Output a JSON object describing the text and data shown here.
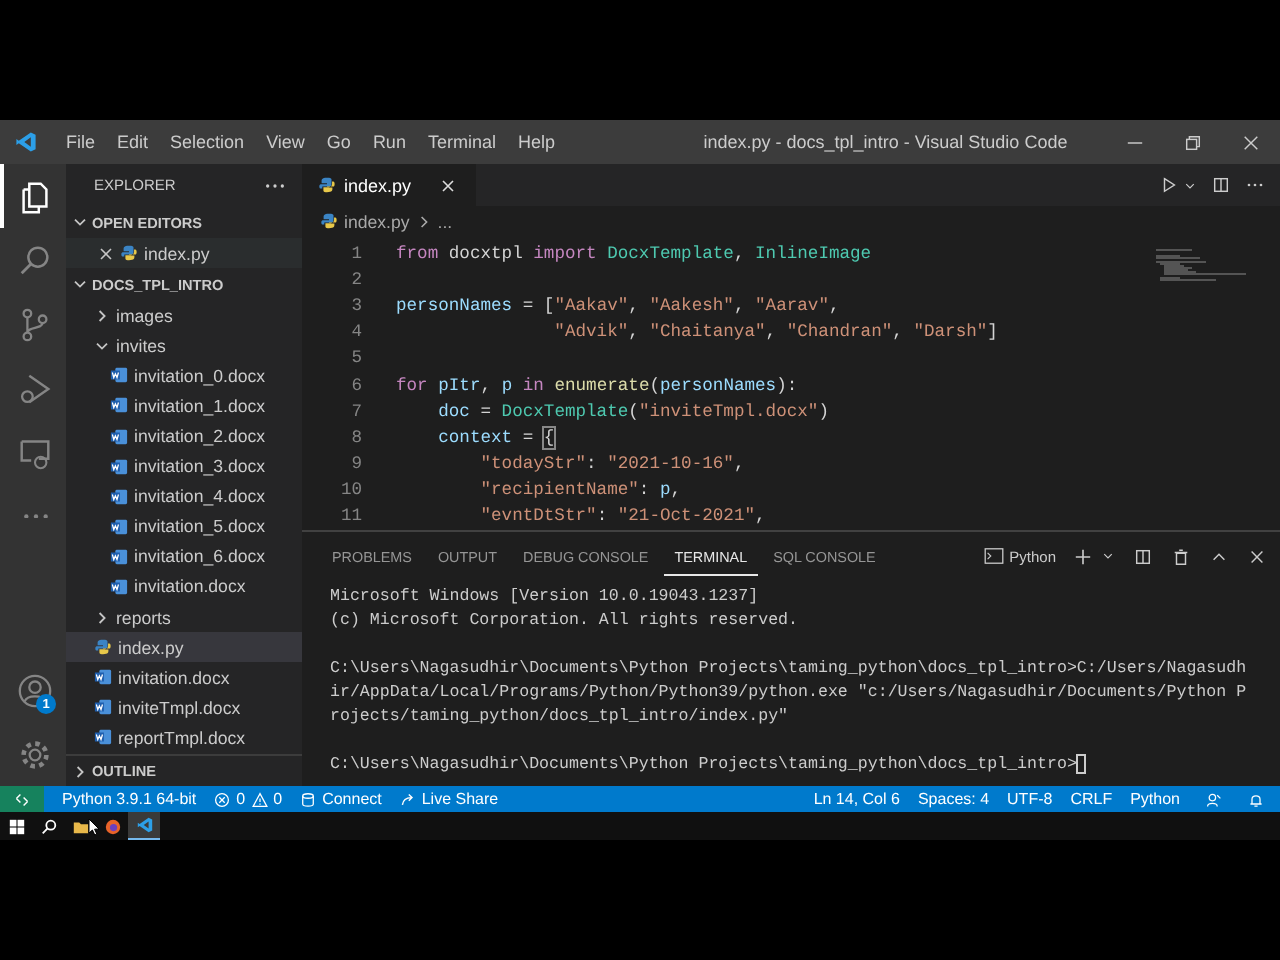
{
  "window": {
    "title": "index.py - docs_tpl_intro - Visual Studio Code"
  },
  "menu": [
    "File",
    "Edit",
    "Selection",
    "View",
    "Go",
    "Run",
    "Terminal",
    "Help"
  ],
  "activity_bar": [
    {
      "kind": "files",
      "selected": true
    },
    {
      "kind": "search",
      "selected": false
    },
    {
      "kind": "source-control",
      "selected": false
    },
    {
      "kind": "run",
      "selected": false
    },
    {
      "kind": "remote",
      "selected": false
    },
    {
      "kind": "more",
      "selected": false
    }
  ],
  "accounts": {
    "badge": "1"
  },
  "sidebar": {
    "title": "EXPLORER",
    "open_editors": {
      "label": "OPEN EDITORS",
      "expanded": true,
      "items": [
        {
          "name": "index.py",
          "kind": "py",
          "selected": true
        }
      ]
    },
    "folder": {
      "label": "DOCS_TPL_INTRO",
      "expanded": true,
      "items": [
        {
          "name": "images",
          "kind": "folder",
          "expanded": false,
          "selected": false
        },
        {
          "name": "invites",
          "kind": "folder",
          "expanded": true,
          "selected": false,
          "children": [
            {
              "name": "invitation_0.docx",
              "kind": "docx",
              "selected": false
            },
            {
              "name": "invitation_1.docx",
              "kind": "docx",
              "selected": false
            },
            {
              "name": "invitation_2.docx",
              "kind": "docx",
              "selected": false
            },
            {
              "name": "invitation_3.docx",
              "kind": "docx",
              "selected": false
            },
            {
              "name": "invitation_4.docx",
              "kind": "docx",
              "selected": false
            },
            {
              "name": "invitation_5.docx",
              "kind": "docx",
              "selected": false
            },
            {
              "name": "invitation_6.docx",
              "kind": "docx",
              "selected": false
            },
            {
              "name": "invitation.docx",
              "kind": "docx",
              "selected": false
            }
          ]
        },
        {
          "name": "reports",
          "kind": "folder",
          "expanded": false,
          "selected": false
        },
        {
          "name": "index.py",
          "kind": "py",
          "selected": true
        },
        {
          "name": "invitation.docx",
          "kind": "docx",
          "selected": false
        },
        {
          "name": "inviteTmpl.docx",
          "kind": "docx",
          "selected": false
        },
        {
          "name": "reportTmpl.docx",
          "kind": "docx",
          "selected": false
        }
      ]
    },
    "outline": {
      "label": "OUTLINE",
      "expanded": false
    }
  },
  "editor": {
    "tabs": [
      {
        "label": "index.py",
        "selected": true
      }
    ],
    "breadcrumb": [
      "index.py",
      "..."
    ],
    "lines": [
      {
        "number": "1",
        "tokens": [
          {
            "kind": "keyword",
            "text": "from"
          },
          {
            "kind": "plain",
            "text": " docxtpl "
          },
          {
            "kind": "keyword",
            "text": "import "
          },
          {
            "kind": "class",
            "text": "DocxTemplate"
          },
          {
            "kind": "plain",
            "text": ", "
          },
          {
            "kind": "class",
            "text": "InlineImage"
          }
        ]
      },
      {
        "number": "2"
      },
      {
        "number": "3",
        "tokens": [
          {
            "kind": "variable",
            "text": "personNames"
          },
          {
            "kind": "plain",
            "text": " = ["
          },
          {
            "kind": "string",
            "text": "\"Aakav\""
          },
          {
            "kind": "plain",
            "text": ", "
          },
          {
            "kind": "string",
            "text": "\"Aakesh\""
          },
          {
            "kind": "plain",
            "text": ", "
          },
          {
            "kind": "string",
            "text": "\"Aarav\""
          },
          {
            "kind": "plain",
            "text": ","
          }
        ]
      },
      {
        "number": "4",
        "tokens": [
          {
            "kind": "string",
            "text": "               \"Advik\""
          },
          {
            "kind": "plain",
            "text": ", "
          },
          {
            "kind": "string",
            "text": "\"Chaitanya\""
          },
          {
            "kind": "plain",
            "text": ", "
          },
          {
            "kind": "string",
            "text": "\"Chandran\""
          },
          {
            "kind": "plain",
            "text": ", "
          },
          {
            "kind": "string",
            "text": "\"Darsh\""
          },
          {
            "kind": "plain",
            "text": "]"
          }
        ]
      },
      {
        "number": "5"
      },
      {
        "number": "6",
        "tokens": [
          {
            "kind": "keyword",
            "text": "for "
          },
          {
            "kind": "variable",
            "text": "pItr"
          },
          {
            "kind": "plain",
            "text": ", "
          },
          {
            "kind": "variable",
            "text": "p "
          },
          {
            "kind": "keyword",
            "text": "in "
          },
          {
            "kind": "function",
            "text": "enumerate"
          },
          {
            "kind": "plain",
            "text": "("
          },
          {
            "kind": "variable",
            "text": "personNames"
          },
          {
            "kind": "plain",
            "text": "):"
          }
        ]
      },
      {
        "number": "7",
        "tokens": [
          {
            "kind": "variable",
            "text": "    doc"
          },
          {
            "kind": "plain",
            "text": " = "
          },
          {
            "kind": "class",
            "text": "DocxTemplate"
          },
          {
            "kind": "plain",
            "text": "("
          },
          {
            "kind": "string",
            "text": "\"inviteTmpl.docx\""
          },
          {
            "kind": "plain",
            "text": ")"
          }
        ]
      },
      {
        "number": "8",
        "tokens": [
          {
            "kind": "variable",
            "text": "    context"
          },
          {
            "kind": "plain",
            "text": " = "
          },
          {
            "kind": "bracket",
            "text": "{"
          }
        ]
      },
      {
        "number": "9",
        "tokens": [
          {
            "kind": "string",
            "text": "        \"todayStr\""
          },
          {
            "kind": "plain",
            "text": ": "
          },
          {
            "kind": "string",
            "text": "\"2021-10-16\""
          },
          {
            "kind": "plain",
            "text": ","
          }
        ]
      },
      {
        "number": "10",
        "tokens": [
          {
            "kind": "string",
            "text": "        \"recipientName\""
          },
          {
            "kind": "plain",
            "text": ": "
          },
          {
            "kind": "variable",
            "text": "p"
          },
          {
            "kind": "plain",
            "text": ","
          }
        ]
      },
      {
        "number": "11",
        "tokens": [
          {
            "kind": "string",
            "text": "        \"evntDtStr\""
          },
          {
            "kind": "plain",
            "text": ": "
          },
          {
            "kind": "string",
            "text": "\"21-Oct-2021\""
          },
          {
            "kind": "plain",
            "text": ","
          }
        ]
      }
    ]
  },
  "panel": {
    "tabs": [
      {
        "label": "PROBLEMS",
        "selected": false
      },
      {
        "label": "OUTPUT",
        "selected": false
      },
      {
        "label": "DEBUG CONSOLE",
        "selected": false
      },
      {
        "label": "TERMINAL",
        "selected": true
      },
      {
        "label": "SQL CONSOLE",
        "selected": false
      }
    ],
    "shell": "Python",
    "terminal_lines": [
      {
        "kind": "output",
        "text": "Microsoft Windows [Version 10.0.19043.1237]"
      },
      {
        "kind": "output",
        "text": "(c) Microsoft Corporation. All rights reserved."
      },
      {
        "kind": "blank"
      },
      {
        "kind": "output",
        "text": "C:\\Users\\Nagasudhir\\Documents\\Python Projects\\taming_python\\docs_tpl_intro>C:/Users/Nagasudh"
      },
      {
        "kind": "output",
        "text": "ir/AppData/Local/Programs/Python/Python39/python.exe \"c:/Users/Nagasudhir/Documents/Python P"
      },
      {
        "kind": "output",
        "text": "rojects/taming_python/docs_tpl_intro/index.py\""
      },
      {
        "kind": "blank"
      },
      {
        "kind": "prompt",
        "text": "C:\\Users\\Nagasudhir\\Documents\\Python Projects\\taming_python\\docs_tpl_intro>"
      }
    ]
  },
  "status_bar": {
    "interpreter": "Python 3.9.1 64-bit",
    "errors": "0",
    "warnings": "0",
    "connect": "Connect",
    "live_share": "Live Share",
    "right": [
      "Ln 14, Col 6",
      "Spaces: 4",
      "UTF-8",
      "CRLF",
      "Python"
    ]
  },
  "taskbar": [
    {
      "kind": "start",
      "selected": false
    },
    {
      "kind": "search",
      "selected": false
    },
    {
      "kind": "folder",
      "selected": false
    },
    {
      "kind": "browser",
      "selected": false
    },
    {
      "kind": "editor",
      "selected": true
    }
  ]
}
